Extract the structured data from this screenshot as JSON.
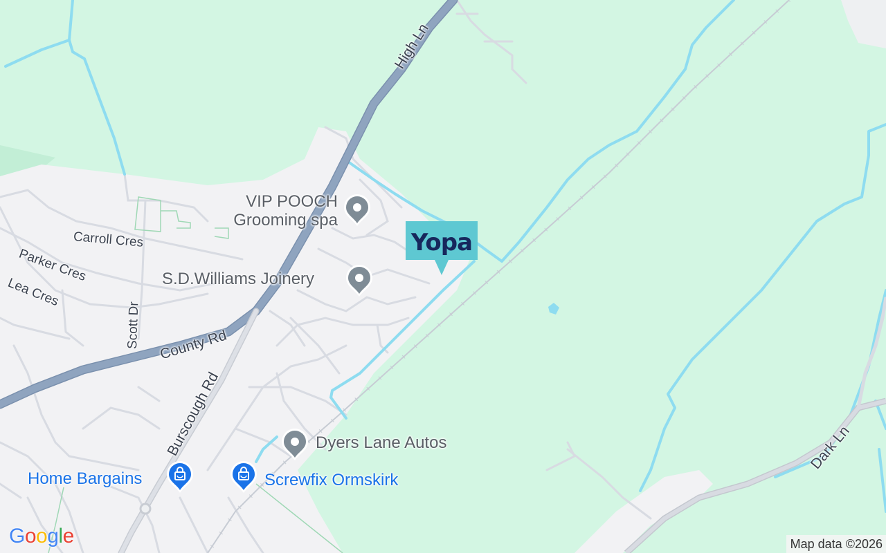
{
  "map": {
    "marker": {
      "brand": "Yopa",
      "color": "#5ec8d2",
      "text_color": "#17275c",
      "icon": "yopa-logo-pin"
    },
    "pois": [
      {
        "id": "vip-pooch",
        "line1": "VIP POOCH",
        "line2": "Grooming spa",
        "icon": "location-pin-icon"
      },
      {
        "id": "sd-williams",
        "label": "S.D.Williams Joinery",
        "icon": "location-pin-icon"
      },
      {
        "id": "dyers-lane",
        "label": "Dyers Lane Autos",
        "icon": "location-pin-icon"
      },
      {
        "id": "home-bargains",
        "label": "Home Bargains",
        "icon": "shopping-bag-icon"
      },
      {
        "id": "screwfix",
        "label": "Screwfix Ormskirk",
        "icon": "shopping-bag-icon"
      }
    ],
    "streets": {
      "high_ln": "High Ln",
      "county_rd": "County Rd",
      "burscough_rd": "Burscough Rd",
      "carroll_cres": "Carroll Cres",
      "parker_cres": "Parker Cres",
      "lea_cres": "Lea Cres",
      "scott_dr": "Scott Dr",
      "dark_ln": "Dark Ln"
    },
    "logo": [
      "G",
      "o",
      "o",
      "g",
      "l",
      "e"
    ],
    "attribution": "Map data ©2026",
    "colors": {
      "green_area": "#d3f6e3",
      "urban_area": "#f2f2f4",
      "water": "#8edcf0",
      "major_road": "#8fa4bf",
      "minor_road": "#d8dbe2",
      "poi_gray": "#7f8c96",
      "shop_blue": "#1a73e8"
    }
  }
}
